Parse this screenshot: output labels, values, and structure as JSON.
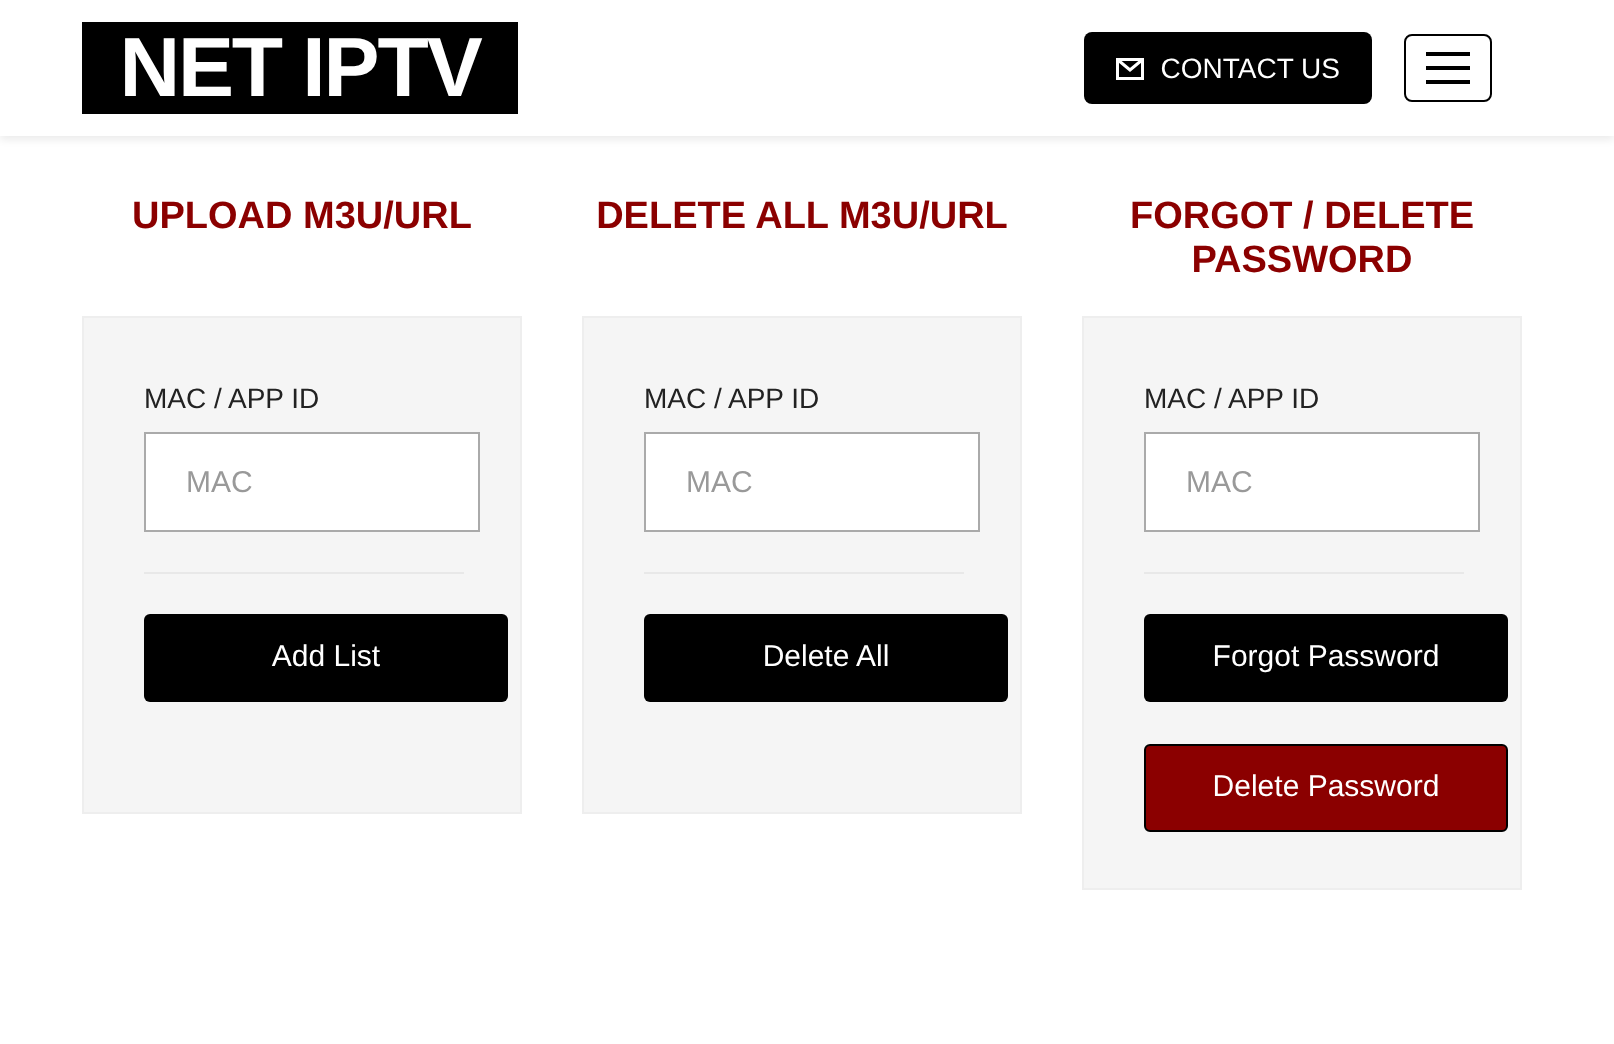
{
  "header": {
    "logo": "NET IPTV",
    "contact_button": "CONTACT US"
  },
  "panels": [
    {
      "title": "UPLOAD M3U/URL",
      "field_label": "MAC / APP ID",
      "placeholder": "MAC",
      "buttons": [
        {
          "label": "Add List",
          "kind": "dark"
        }
      ]
    },
    {
      "title": "DELETE ALL M3U/URL",
      "field_label": "MAC / APP ID",
      "placeholder": "MAC",
      "buttons": [
        {
          "label": "Delete All",
          "kind": "dark"
        }
      ]
    },
    {
      "title": "FORGOT / DELETE PASSWORD",
      "field_label": "MAC / APP ID",
      "placeholder": "MAC",
      "buttons": [
        {
          "label": "Forgot Password",
          "kind": "dark"
        },
        {
          "label": "Delete Password",
          "kind": "danger"
        }
      ]
    }
  ]
}
